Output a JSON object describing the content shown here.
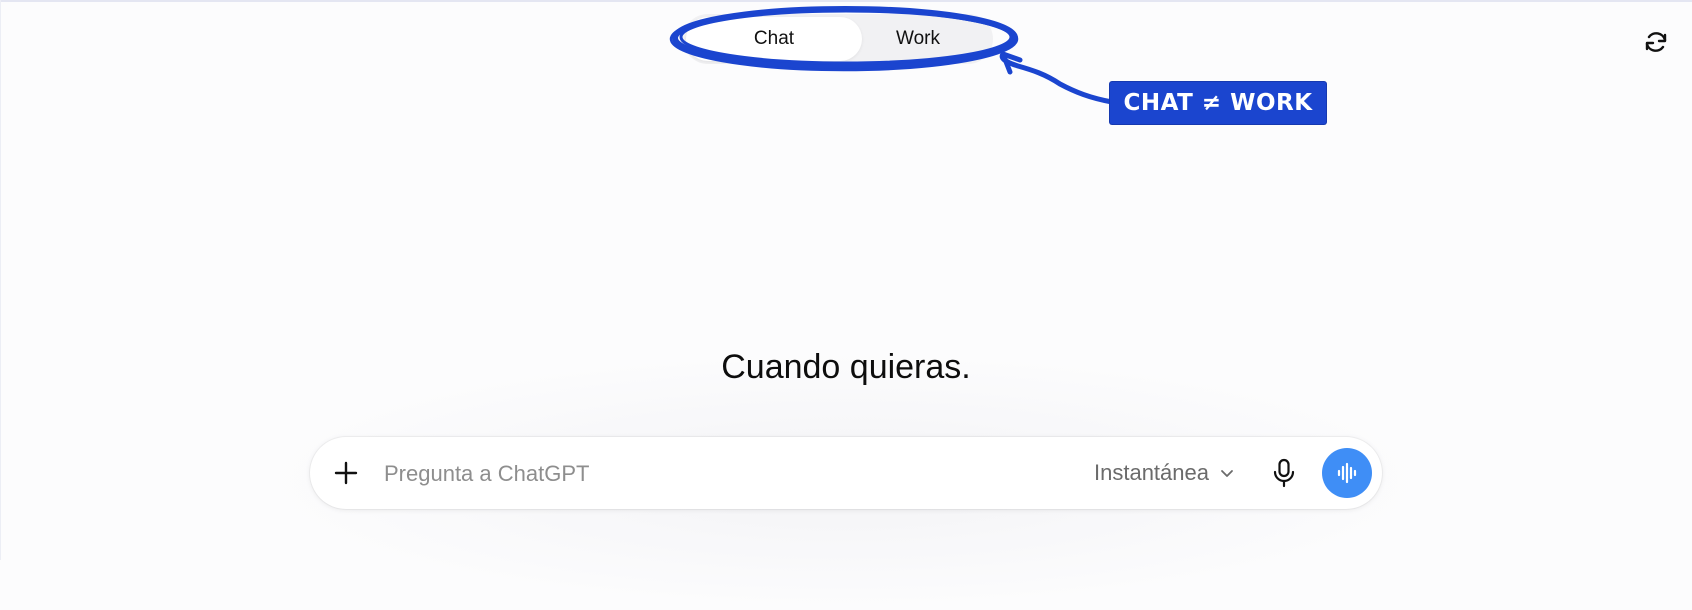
{
  "header": {
    "tabs": [
      {
        "label": "Chat",
        "selected": true
      },
      {
        "label": "Work",
        "selected": false
      }
    ],
    "annotation_label": "CHAT ≠ WORK",
    "refresh_icon": "refresh-cycle-icon"
  },
  "main": {
    "headline": "Cuando quieras."
  },
  "composer": {
    "placeholder": "Pregunta a ChatGPT",
    "value": "",
    "model_label": "Instantánea",
    "icons": {
      "attach": "plus-icon",
      "model_dropdown": "chevron-down-icon",
      "dictate": "microphone-icon",
      "voice_mode": "sound-wave-icon"
    }
  },
  "colors": {
    "annotation": "#1b45cf",
    "voice_button": "#3f8ef6",
    "background": "#fcfcfd"
  }
}
